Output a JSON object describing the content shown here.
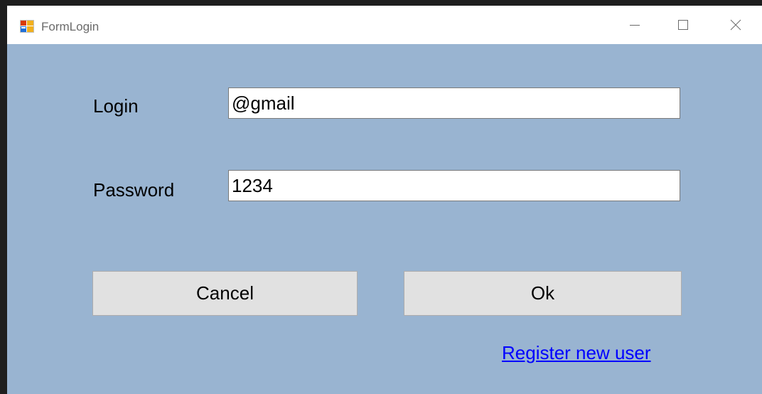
{
  "window": {
    "title": "FormLogin",
    "icon": "winforms-app-icon",
    "controls": {
      "minimize": "minimize-icon",
      "maximize": "maximize-icon",
      "close": "close-icon"
    }
  },
  "form": {
    "login_label": "Login",
    "login_value": "@gmail",
    "password_label": "Password",
    "password_value": "1234"
  },
  "buttons": {
    "cancel_label": "Cancel",
    "ok_label": "Ok"
  },
  "register_link": "Register new user",
  "colors": {
    "form_background": "#99b4d1",
    "button_face": "#e1e1e1",
    "link": "#0000ff"
  }
}
